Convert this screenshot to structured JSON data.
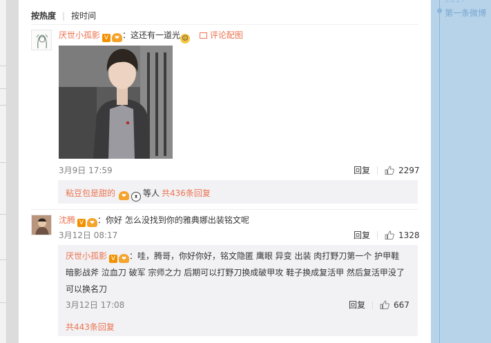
{
  "sort": {
    "hot": "按热度",
    "time": "按时间"
  },
  "right_timeline": {
    "top_fragment": "2017",
    "first_weibo": "第一条微博"
  },
  "comments": [
    {
      "user": "厌世小孤影",
      "text": "：这还有一道光",
      "pic_link": "评论配图",
      "time": "3月9日 17:59",
      "reply": "回复",
      "likes": "2297",
      "sub_summary": {
        "users": "粘豆包是甜的",
        "tail": "等人",
        "count": "共436条回复"
      }
    },
    {
      "user": "沈腾",
      "text": "：你好 怎么没找到你的雅典娜出装铭文呢",
      "time": "3月12日 08:17",
      "reply": "回复",
      "likes": "1328",
      "sub_reply": {
        "user": "厌世小孤影",
        "line1": "：哇，腾哥，你好你好，铭文隐匿 鹰眼 异变 出装 肉打野刀第一个 护甲鞋",
        "line2": "暗影战斧 泣血刀 破军 宗师之力 后期可以打野刀换成破甲攻 鞋子换成复活甲 然后复活甲没了",
        "line3": "可以换名刀",
        "time": "3月12日 17:08",
        "reply": "回复",
        "likes": "667"
      },
      "sub_total": "共443条回复"
    }
  ],
  "colors": {
    "accent": "#eb7350",
    "panel_bg": "#ffffff",
    "sub_bg": "#f2f2f5",
    "right_bg": "#b6d3ea"
  }
}
